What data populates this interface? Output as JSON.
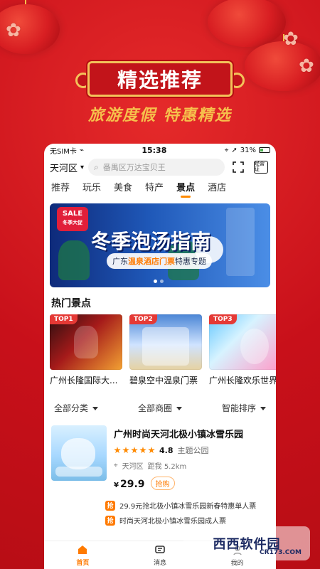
{
  "promo": {
    "banner_title": "精选推荐",
    "subtitle": "旅游度假 特惠精选"
  },
  "status_bar": {
    "carrier": "无SIM卡",
    "time": "15:38",
    "battery": "31%"
  },
  "search": {
    "city": "天河区",
    "placeholder": "番禺区万达宝贝王",
    "icons": [
      "scan-icon",
      "license-icon"
    ],
    "license_label": "经营证"
  },
  "tabs": [
    "推荐",
    "玩乐",
    "美食",
    "特产",
    "景点",
    "酒店"
  ],
  "active_tab_index": 4,
  "hero": {
    "sale_badge_top": "SALE",
    "sale_badge_bottom": "冬季大促",
    "title": "冬季泡汤指南",
    "subtitle_prefix": "广东",
    "subtitle_highlight": "温泉酒店门票",
    "subtitle_suffix": "特惠专题",
    "slides": 2,
    "active_slide": 0
  },
  "hot_section": {
    "title": "热门景点",
    "items": [
      {
        "badge": "TOP1",
        "name": "广州长隆国际大..."
      },
      {
        "badge": "TOP2",
        "name": "碧泉空中温泉门票"
      },
      {
        "badge": "TOP3",
        "name": "广州长隆欢乐世界"
      }
    ]
  },
  "filters": [
    "全部分类",
    "全部商圈",
    "智能排序"
  ],
  "listing": {
    "title": "广州时尚天河北极小镇冰雪乐园",
    "rating": "4.8",
    "category": "主题公园",
    "district": "天河区",
    "distance": "距我 5.2km",
    "currency": "¥",
    "price": "29.9",
    "tag": "抢购",
    "offers": [
      {
        "badge": "抢",
        "text": "29.9元抢北极小镇冰雪乐园新春特惠单人票"
      },
      {
        "badge": "抢",
        "text": "时尚天河北极小镇冰雪乐园成人票"
      }
    ]
  },
  "bottom_nav": [
    {
      "label": "首页",
      "icon": "home-icon",
      "active": true
    },
    {
      "label": "消息",
      "icon": "message-icon",
      "active": false
    },
    {
      "label": "我的",
      "icon": "profile-icon",
      "active": false
    }
  ],
  "watermark": {
    "text": "西西软件园",
    "url_text": "CR173.COM"
  },
  "colors": {
    "bg_red": "#d3171b",
    "accent_orange": "#ff8a00",
    "gold": "#f3c25a"
  }
}
